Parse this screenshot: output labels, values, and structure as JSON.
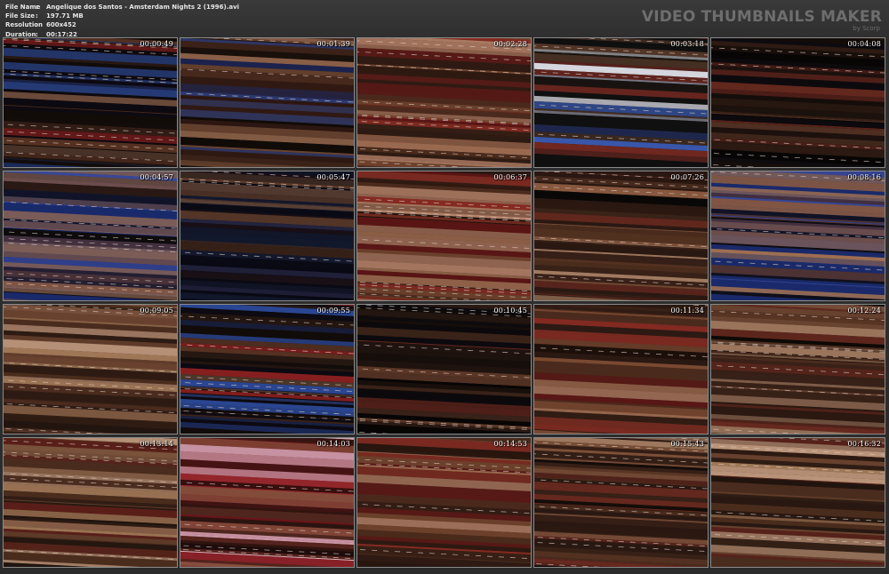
{
  "file_info": [
    {
      "key": "File Name",
      "sep": ":",
      "value": "Angelique dos Santos - Amsterdam Nights 2 (1996).avi"
    },
    {
      "key": "File Size",
      "sep": ":",
      "value": "197.71 MB"
    },
    {
      "key": "Resolution",
      "sep": ":",
      "value": "600x452"
    },
    {
      "key": "Duration",
      "sep": ":",
      "value": "00:17:22"
    }
  ],
  "brand": {
    "title": "VIDEO THUMBNAILS MAKER",
    "subtitle": "by Scorp"
  },
  "thumbnails": [
    {
      "timestamp": "00:00:49",
      "palette": "dark-blue"
    },
    {
      "timestamp": "00:01:39",
      "palette": "brown-blue"
    },
    {
      "timestamp": "00:02:28",
      "palette": "brown-red"
    },
    {
      "timestamp": "00:03:18",
      "palette": "blue-white"
    },
    {
      "timestamp": "00:04:08",
      "palette": "dark"
    },
    {
      "timestamp": "00:04:57",
      "palette": "blue-brown"
    },
    {
      "timestamp": "00:05:47",
      "palette": "dark-navy"
    },
    {
      "timestamp": "00:06:37",
      "palette": "brown-red"
    },
    {
      "timestamp": "00:07:26",
      "palette": "brown-dark"
    },
    {
      "timestamp": "00:08:16",
      "palette": "blue-brown"
    },
    {
      "timestamp": "00:09:05",
      "palette": "brown"
    },
    {
      "timestamp": "00:09:55",
      "palette": "dark-blue"
    },
    {
      "timestamp": "00:10:45",
      "palette": "dark"
    },
    {
      "timestamp": "00:11:34",
      "palette": "brown-red"
    },
    {
      "timestamp": "00:12:24",
      "palette": "brown-dark"
    },
    {
      "timestamp": "00:13:14",
      "palette": "brown"
    },
    {
      "timestamp": "00:14:03",
      "palette": "red-pink"
    },
    {
      "timestamp": "00:14:53",
      "palette": "brown-red"
    },
    {
      "timestamp": "00:15:43",
      "palette": "brown-dark"
    },
    {
      "timestamp": "00:16:32",
      "palette": "brown"
    }
  ],
  "colors": {
    "background": "#2e2e2e",
    "header_text": "#e6e6e6",
    "brand_text": "#6e6e6e",
    "thumb_border": "#8a8a8a",
    "timestamp_text": "#ffffff"
  }
}
